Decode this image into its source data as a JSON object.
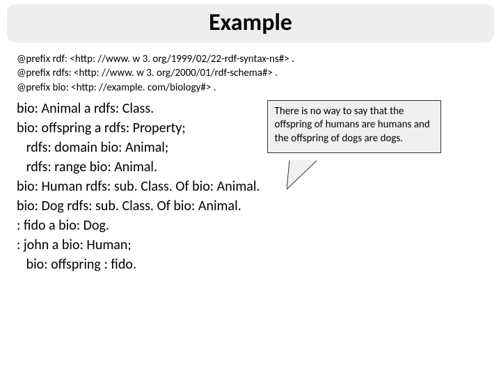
{
  "title": "Example",
  "prefixes": [
    "@prefix rdf: <http: //www. w 3. org/1999/02/22-rdf-syntax-ns#> .",
    "@prefix rdfs: <http: //www. w 3. org/2000/01/rdf-schema#> .",
    "@prefix bio: <http: //example. com/biology#> ."
  ],
  "code": "bio: Animal a rdfs: Class.\nbio: offspring a rdfs: Property;\n   rdfs: domain bio: Animal;\n   rdfs: range bio: Animal.\nbio: Human rdfs: sub. Class. Of bio: Animal.\nbio: Dog rdfs: sub. Class. Of bio: Animal.\n: fido a bio: Dog.\n: john a bio: Human;\n   bio: offspring : fido.",
  "callout": "There is no way to say that the offspring of humans are humans and the offspring of dogs are dogs."
}
